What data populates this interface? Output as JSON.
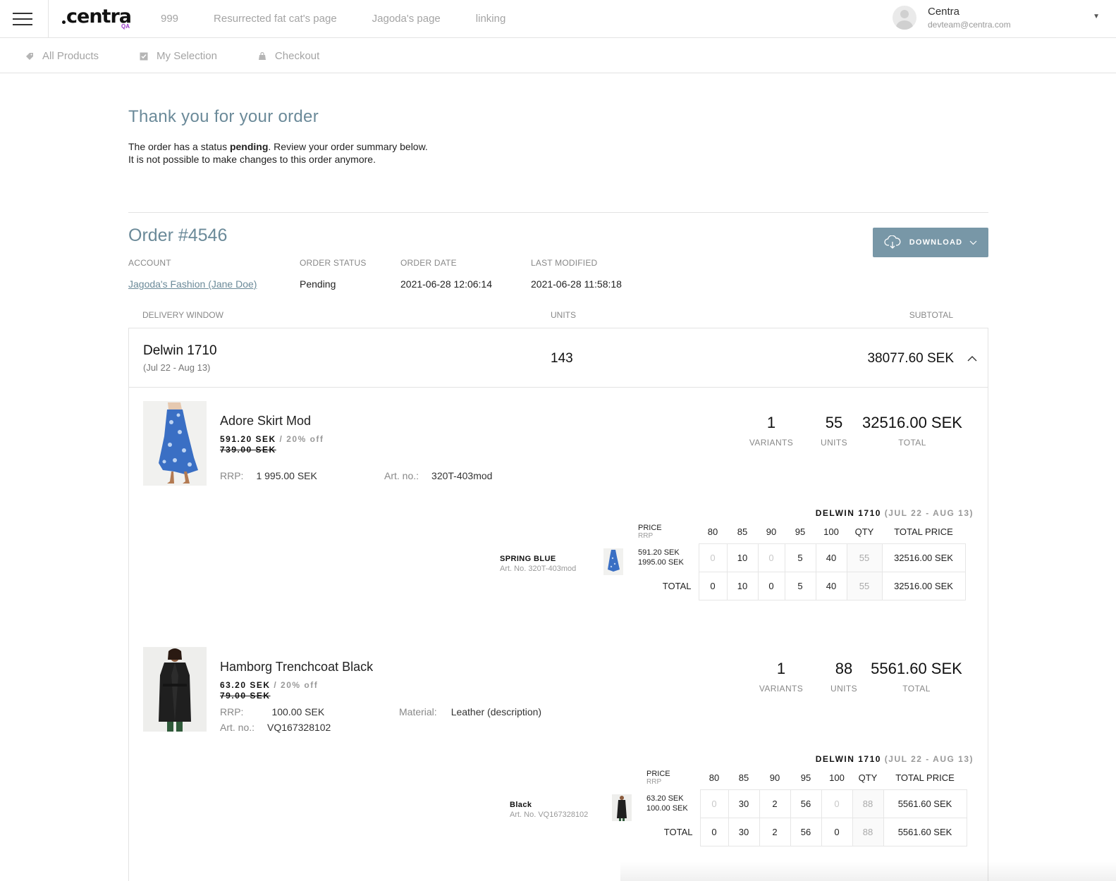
{
  "header": {
    "logo": "centra",
    "logo_badge": "QA",
    "nav": [
      "999",
      "Resurrected fat cat's page",
      "Jagoda's page",
      "linking"
    ],
    "user": {
      "name": "Centra",
      "email": "devteam@centra.com"
    }
  },
  "subnav": [
    "All Products",
    "My Selection",
    "Checkout"
  ],
  "confirmation": {
    "title": "Thank you for your order",
    "status_prefix": "The order has a status ",
    "status": "pending",
    "status_suffix": ". Review your order summary below.",
    "note": "It is not possible to make changes to this order anymore."
  },
  "order": {
    "title": "Order #4546",
    "download_label": "DOWNLOAD",
    "meta": {
      "account_label": "ACCOUNT",
      "account_value": "Jagoda's Fashion (Jane Doe)",
      "status_label": "ORDER STATUS",
      "status_value": "Pending",
      "date_label": "ORDER DATE",
      "date_value": "2021-06-28 12:06:14",
      "modified_label": "LAST MODIFIED",
      "modified_value": "2021-06-28 11:58:18"
    },
    "columns": {
      "window": "DELIVERY WINDOW",
      "units": "UNITS",
      "subtotal": "SUBTOTAL"
    },
    "window": {
      "name": "Delwin 1710",
      "dates": "(Jul 22 - Aug 13)",
      "units": "143",
      "subtotal": "38077.60 SEK"
    }
  },
  "products": [
    {
      "name": "Adore Skirt Mod",
      "price": "591.20 SEK",
      "discount": " / 20% off",
      "old_price": "739.00 SEK",
      "rrp_label": "RRP:",
      "rrp_value": "1 995.00 SEK",
      "art_label": "Art. no.:",
      "art_value": "320T-403mod",
      "variants_count": "1",
      "variants_label": "VARIANTS",
      "units_count": "55",
      "units_label": "UNITS",
      "total": "32516.00 SEK",
      "total_label": "TOTAL",
      "dw_name": "DELWIN 1710",
      "dw_range": "(JUL 22 - AUG 13)",
      "table": {
        "price_header": "PRICE",
        "rrp_header": "RRP",
        "sizes": [
          "80",
          "85",
          "90",
          "95",
          "100"
        ],
        "qty_header": "QTY",
        "total_price_header": "TOTAL PRICE",
        "variant_name": "SPRING BLUE",
        "variant_art": "Art. No. 320T-403mod",
        "variant_price": "591.20 SEK",
        "variant_rrp": "1995.00 SEK",
        "row": [
          "0",
          "10",
          "0",
          "5",
          "40"
        ],
        "row_qty": "55",
        "row_total": "32516.00 SEK",
        "total_label": "TOTAL",
        "totals": [
          "0",
          "10",
          "0",
          "5",
          "40"
        ],
        "totals_qty": "55",
        "totals_price": "32516.00 SEK"
      }
    },
    {
      "name": "Hamborg Trenchcoat Black",
      "price": "63.20 SEK",
      "discount": " / 20% off",
      "old_price": "79.00 SEK",
      "rrp_label": "RRP:",
      "rrp_value": "100.00 SEK",
      "art_label": "Art. no.:",
      "art_value": "VQ167328102",
      "material_label": "Material:",
      "material_value": "Leather (description)",
      "variants_count": "1",
      "variants_label": "VARIANTS",
      "units_count": "88",
      "units_label": "UNITS",
      "total": "5561.60 SEK",
      "total_label": "TOTAL",
      "dw_name": "DELWIN 1710",
      "dw_range": "(JUL 22 - AUG 13)",
      "table": {
        "price_header": "PRICE",
        "rrp_header": "RRP",
        "sizes": [
          "80",
          "85",
          "90",
          "95",
          "100"
        ],
        "qty_header": "QTY",
        "total_price_header": "TOTAL PRICE",
        "variant_name": "Black",
        "variant_art": "Art. No. VQ167328102",
        "variant_price": "63.20 SEK",
        "variant_rrp": "100.00 SEK",
        "row": [
          "0",
          "30",
          "2",
          "56",
          "0"
        ],
        "row_qty": "88",
        "row_total": "5561.60 SEK",
        "total_label": "TOTAL",
        "totals": [
          "0",
          "30",
          "2",
          "56",
          "0"
        ],
        "totals_qty": "88",
        "totals_price": "5561.60 SEK"
      }
    }
  ]
}
